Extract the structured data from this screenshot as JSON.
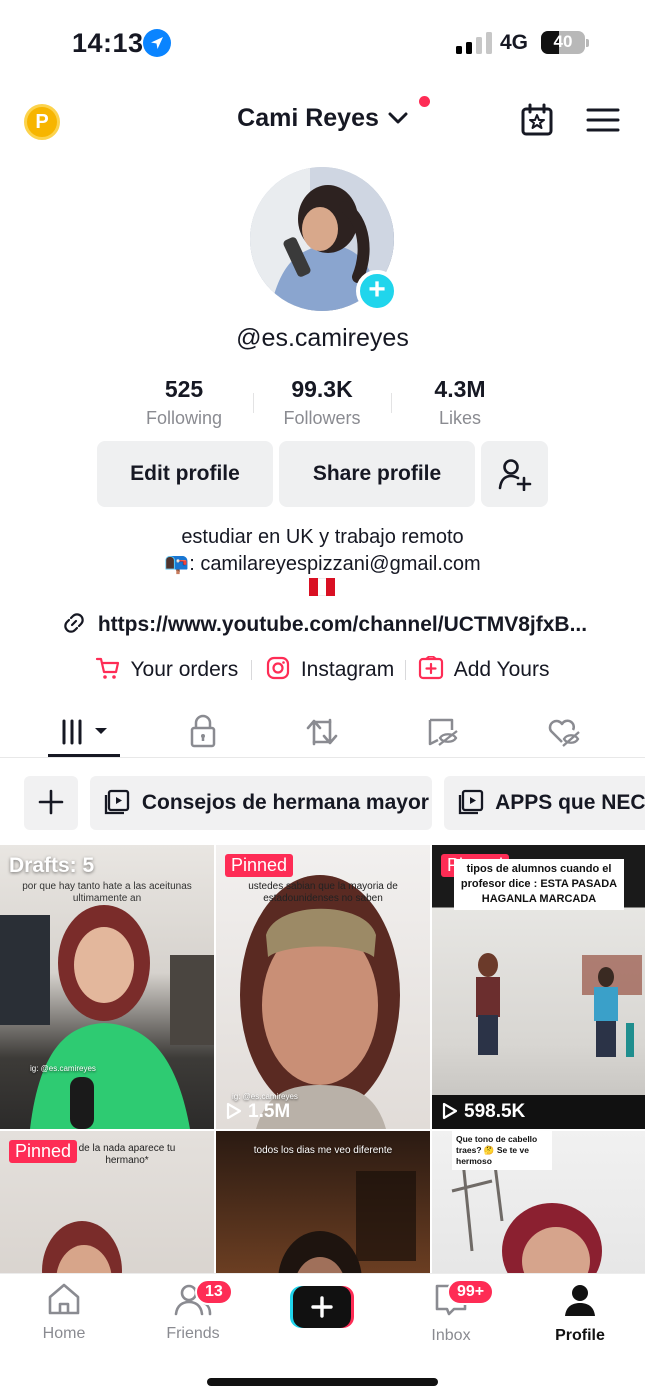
{
  "status_bar": {
    "time": "14:13",
    "network": "4G",
    "battery": "40",
    "battery_level": 0.4
  },
  "header": {
    "coin_label": "P",
    "username": "Cami Reyes"
  },
  "profile": {
    "handle": "@es.camireyes",
    "stats": [
      {
        "value": "525",
        "label": "Following"
      },
      {
        "value": "99.3K",
        "label": "Followers"
      },
      {
        "value": "4.3M",
        "label": "Likes"
      }
    ],
    "edit_label": "Edit profile",
    "share_label": "Share profile",
    "bio_line1": "estudiar en UK y trabajo remoto",
    "bio_email": "📭: camilareyespizzani@gmail.com",
    "link": "https://www.youtube.com/channel/UCTMV8jfxB...",
    "quick_links": [
      "Your orders",
      "Instagram",
      "Add Yours"
    ]
  },
  "playlists": {
    "items": [
      "Consejos de hermana mayor",
      "APPS que NECE"
    ]
  },
  "videos": [
    {
      "label": "Drafts: 5",
      "caption": "por que hay tanto hate a las aceitunas ultimamente an",
      "watermark": "ig: @es.camireyes"
    },
    {
      "label": "Pinned",
      "caption": "ustedes sabian que la mayoria de estadounidenses no saben",
      "watermark": "ig: @es.camireyes",
      "views": "1.5M"
    },
    {
      "label": "Pinned",
      "caption": "tipos de alumnos cuando el profesor dice : ESTA PASADA HAGANLA MARCADA",
      "views": "598.5K"
    },
    {
      "label": "Pinned",
      "caption": "de la nada aparece tu hermano*"
    },
    {
      "caption": "todos los dias me veo diferente"
    },
    {
      "caption": "Que tono de cabello traes? 🤔 Se te ve hermoso"
    }
  ],
  "nav": {
    "home": "Home",
    "friends": "Friends",
    "friends_badge": "13",
    "inbox": "Inbox",
    "inbox_badge": "99+",
    "profile": "Profile"
  },
  "colors": {
    "accent": "#fe2c55",
    "cyan": "#20d5ec",
    "chip_bg": "#f1f1f2",
    "text_secondary": "#8a8b91"
  }
}
